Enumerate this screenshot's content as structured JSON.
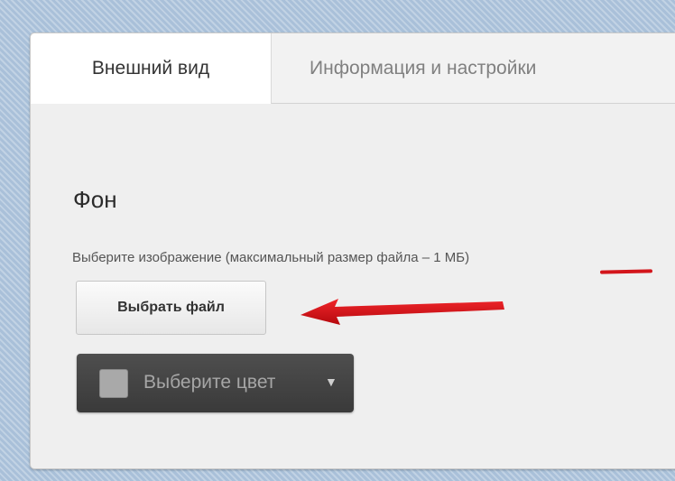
{
  "tabs": [
    {
      "label": "Внешний вид",
      "active": true
    },
    {
      "label": "Информация и настройки",
      "active": false
    }
  ],
  "background_section": {
    "title": "Фон",
    "hint_prefix": "Выберите изображение (максимальный размер файла – ",
    "hint_size": "1 МБ",
    "hint_suffix": ")",
    "file_button_label": "Выбрать файл",
    "color_button_label": "Выберите цвет",
    "swatch_color": "#a9a9a9"
  },
  "colors": {
    "annotation_red": "#d3151b",
    "page_background": "#a9c0d9",
    "panel_background": "#efefef",
    "color_button_background": "#404040"
  },
  "icons": {
    "caret": "dropdown-caret-icon",
    "arrow": "annotation-arrow-icon"
  }
}
